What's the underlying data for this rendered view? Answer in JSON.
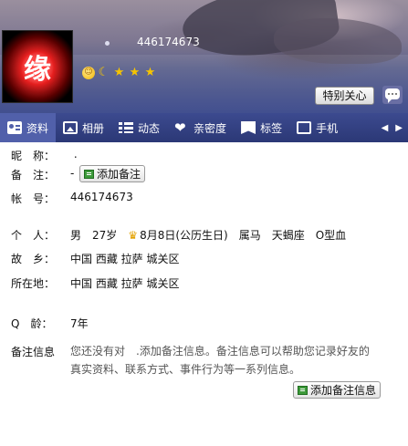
{
  "header": {
    "qq_number": "446174673",
    "avatar_glyph": "缘",
    "level_icons": [
      {
        "name": "sun-level-icon",
        "glyph": "☺"
      },
      {
        "name": "moon-level-icon",
        "glyph": "☾"
      },
      {
        "name": "star-level-icon",
        "glyph": "★"
      },
      {
        "name": "star-level-icon",
        "glyph": "★"
      },
      {
        "name": "star-level-icon",
        "glyph": "★"
      }
    ],
    "special_care_label": "特别关心"
  },
  "tabs": [
    {
      "label": "资料",
      "icon": "profile-card-icon",
      "active": true
    },
    {
      "label": "相册",
      "icon": "photo-album-icon",
      "active": false
    },
    {
      "label": "动态",
      "icon": "feed-list-icon",
      "active": false
    },
    {
      "label": "亲密度",
      "icon": "heart-icon",
      "active": false
    },
    {
      "label": "标签",
      "icon": "bookmark-tag-icon",
      "active": false
    },
    {
      "label": "手机",
      "icon": "mobile-phone-icon",
      "active": false
    }
  ],
  "tab_arrows": {
    "left": "◀",
    "right": "▶"
  },
  "profile": {
    "nickname_label": "昵　称：",
    "nickname_value": " .",
    "remark_label": "备　注：",
    "remark_value": "-",
    "add_remark_label": "添加备注",
    "account_label": "帐　号：",
    "account_value": "446174673",
    "personal_label": "个　人：",
    "gender": "男",
    "age": "27岁",
    "birthday": "8月8日(公历生日)",
    "zodiac": "属马",
    "constellation": "天蝎座",
    "blood_type": "O型血",
    "hometown_label": "故　乡：",
    "hometown_value": "中国 西藏 拉萨 城关区",
    "location_label": "所在地：",
    "location_value": "中国 西藏 拉萨 城关区",
    "qage_label": "Q　龄：",
    "qage_value": "7年",
    "notes_label": "备注信息",
    "notes_line1": "您还没有对　.添加备注信息。备注信息可以帮助您记录好友的",
    "notes_line2": "真实资料、联系方式、事件行为等一系列信息。",
    "add_notes_label": "添加备注信息"
  }
}
